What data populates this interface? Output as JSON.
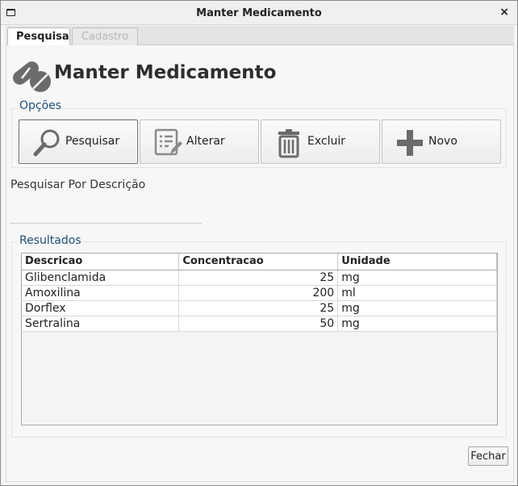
{
  "window": {
    "title": "Manter Medicamento"
  },
  "tabs": [
    {
      "label": "Pesquisa",
      "active": true
    },
    {
      "label": "Cadastro",
      "active": false
    }
  ],
  "header": {
    "title": "Manter Medicamento",
    "icon": "pills-icon"
  },
  "options": {
    "label": "Opções",
    "buttons": [
      {
        "label": "Pesquisar",
        "icon": "search-icon"
      },
      {
        "label": "Alterar",
        "icon": "edit-list-icon"
      },
      {
        "label": "Excluir",
        "icon": "trash-icon"
      },
      {
        "label": "Novo",
        "icon": "plus-icon"
      }
    ]
  },
  "search": {
    "label": "Pesquisar Por Descrição",
    "value": ""
  },
  "results": {
    "label": "Resultados",
    "columns": [
      "Descricao",
      "Concentracao",
      "Unidade"
    ],
    "rows": [
      [
        "Glibenclamida",
        "25",
        "mg"
      ],
      [
        "Amoxilina",
        "200",
        "ml"
      ],
      [
        "Dorflex",
        "25",
        "mg"
      ],
      [
        "Sertralina",
        "50",
        "mg"
      ]
    ]
  },
  "footer": {
    "close_label": "Fechar"
  },
  "colors": {
    "accent_text": "#1f4e79",
    "icon_gray": "#6b6b6b"
  }
}
